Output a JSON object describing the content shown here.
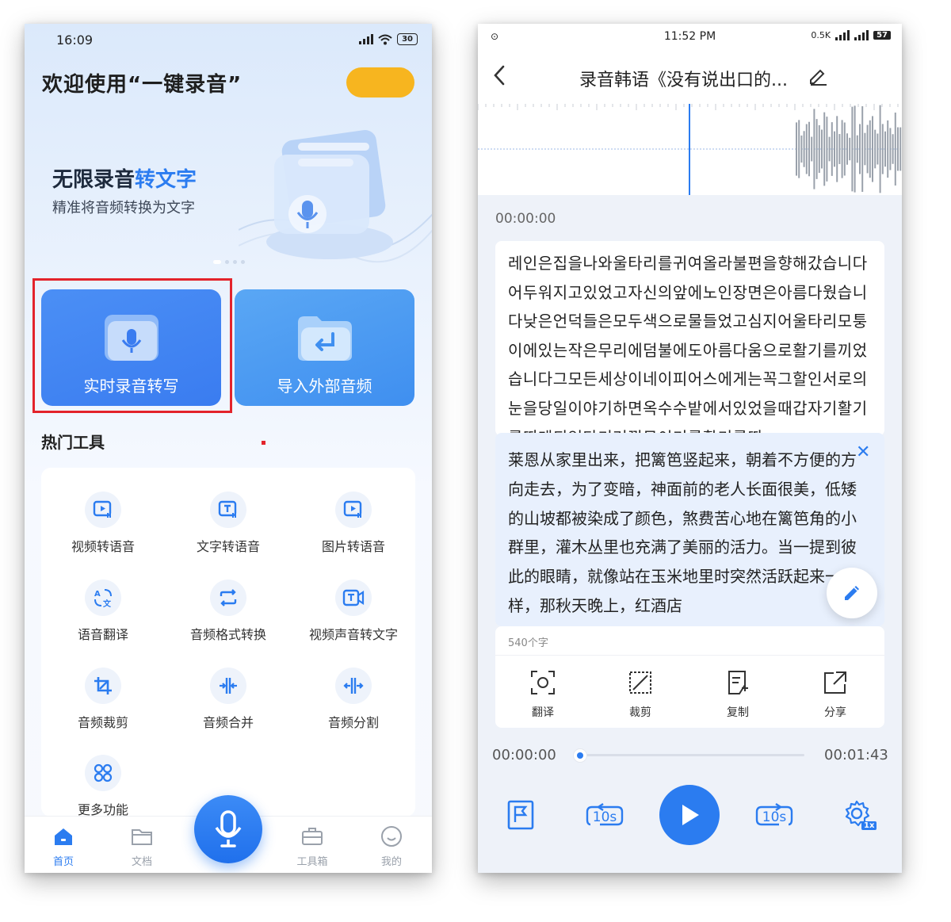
{
  "left_screen": {
    "status_bar": {
      "time": "16:09",
      "battery": "30"
    },
    "header": {
      "welcome_text": "欢迎使用“一键录音”"
    },
    "banner": {
      "title_part1": "无限录音",
      "title_part2": "转文字",
      "subtitle": "精准将音频转换为文字"
    },
    "main_cards": [
      {
        "label": "实时录音转写",
        "highlighted": true
      },
      {
        "label": "导入外部音频"
      }
    ],
    "hot_tools": {
      "title": "热门工具",
      "items": [
        {
          "label": "视频转语音",
          "icon": "video-play-icon"
        },
        {
          "label": "文字转语音",
          "icon": "text-to-speech-icon"
        },
        {
          "label": "图片转语音",
          "icon": "image-play-icon"
        },
        {
          "label": "语音翻译",
          "icon": "translate-icon"
        },
        {
          "label": "音频格式转换",
          "icon": "convert-arrows-icon"
        },
        {
          "label": "视频声音转文字",
          "icon": "video-text-icon"
        },
        {
          "label": "音频裁剪",
          "icon": "crop-icon"
        },
        {
          "label": "音频合并",
          "icon": "merge-icon"
        },
        {
          "label": "音频分割",
          "icon": "split-icon"
        },
        {
          "label": "更多功能",
          "icon": "more-grid-icon"
        }
      ]
    },
    "tabbar": {
      "items": [
        {
          "label": "首页",
          "icon": "home-icon",
          "active": true
        },
        {
          "label": "文档",
          "icon": "folder-icon"
        },
        {
          "label": "工具箱",
          "icon": "toolbox-icon"
        },
        {
          "label": "我的",
          "icon": "profile-icon"
        }
      ]
    },
    "colors": {
      "accent": "#2b7cf0",
      "vip": "#f7b51f",
      "highlight_border": "#e3232b"
    }
  },
  "right_screen": {
    "status_bar": {
      "time": "11:52 PM",
      "speed": "0.5K",
      "battery": "57"
    },
    "nav": {
      "title": "录音韩语《没有说出口的..."
    },
    "waveform_time": "00:00:00",
    "original_text": "레인은집을나와울타리를귀여올라불편을향해갔습니다어두워지고있었고자신의앞에노인장면은아름다웠습니다낮은언덕들은모두색으로물들었고심지어울타리모퉁이에있는작은무리에덤불에도아름다움으로활기를끼었습니다그모든세상이네이피어스에게는꼭그할인서로의눈을당일이야기하면옥수수밭에서있었을때갑자기활기를띠게되었다기러껍무이기를활기를띠",
    "translation_text": "莱恩从家里出来，把篱笆竖起来，朝着不方便的方向走去，为了变暗，神面前的老人长面很美，低矮的山坡都被染成了颜色，煞费苦心地在篱笆角的小群里，灌木丛里也充满了美丽的活力。当一提到彼此的眼睛，就像站在玉米地里时突然活跃起来一样，那秋天晚上，红酒店",
    "char_count": "540个字",
    "actions": [
      {
        "label": "翻译",
        "icon": "translate-scan-icon"
      },
      {
        "label": "裁剪",
        "icon": "crop-icon"
      },
      {
        "label": "复制",
        "icon": "copy-icon"
      },
      {
        "label": "分享",
        "icon": "share-icon"
      }
    ],
    "player": {
      "current_time": "00:00:00",
      "total_time": "00:01:43",
      "progress": 0.0,
      "rewind_label": "10s",
      "forward_label": "10s",
      "speed_label": "1x"
    }
  }
}
